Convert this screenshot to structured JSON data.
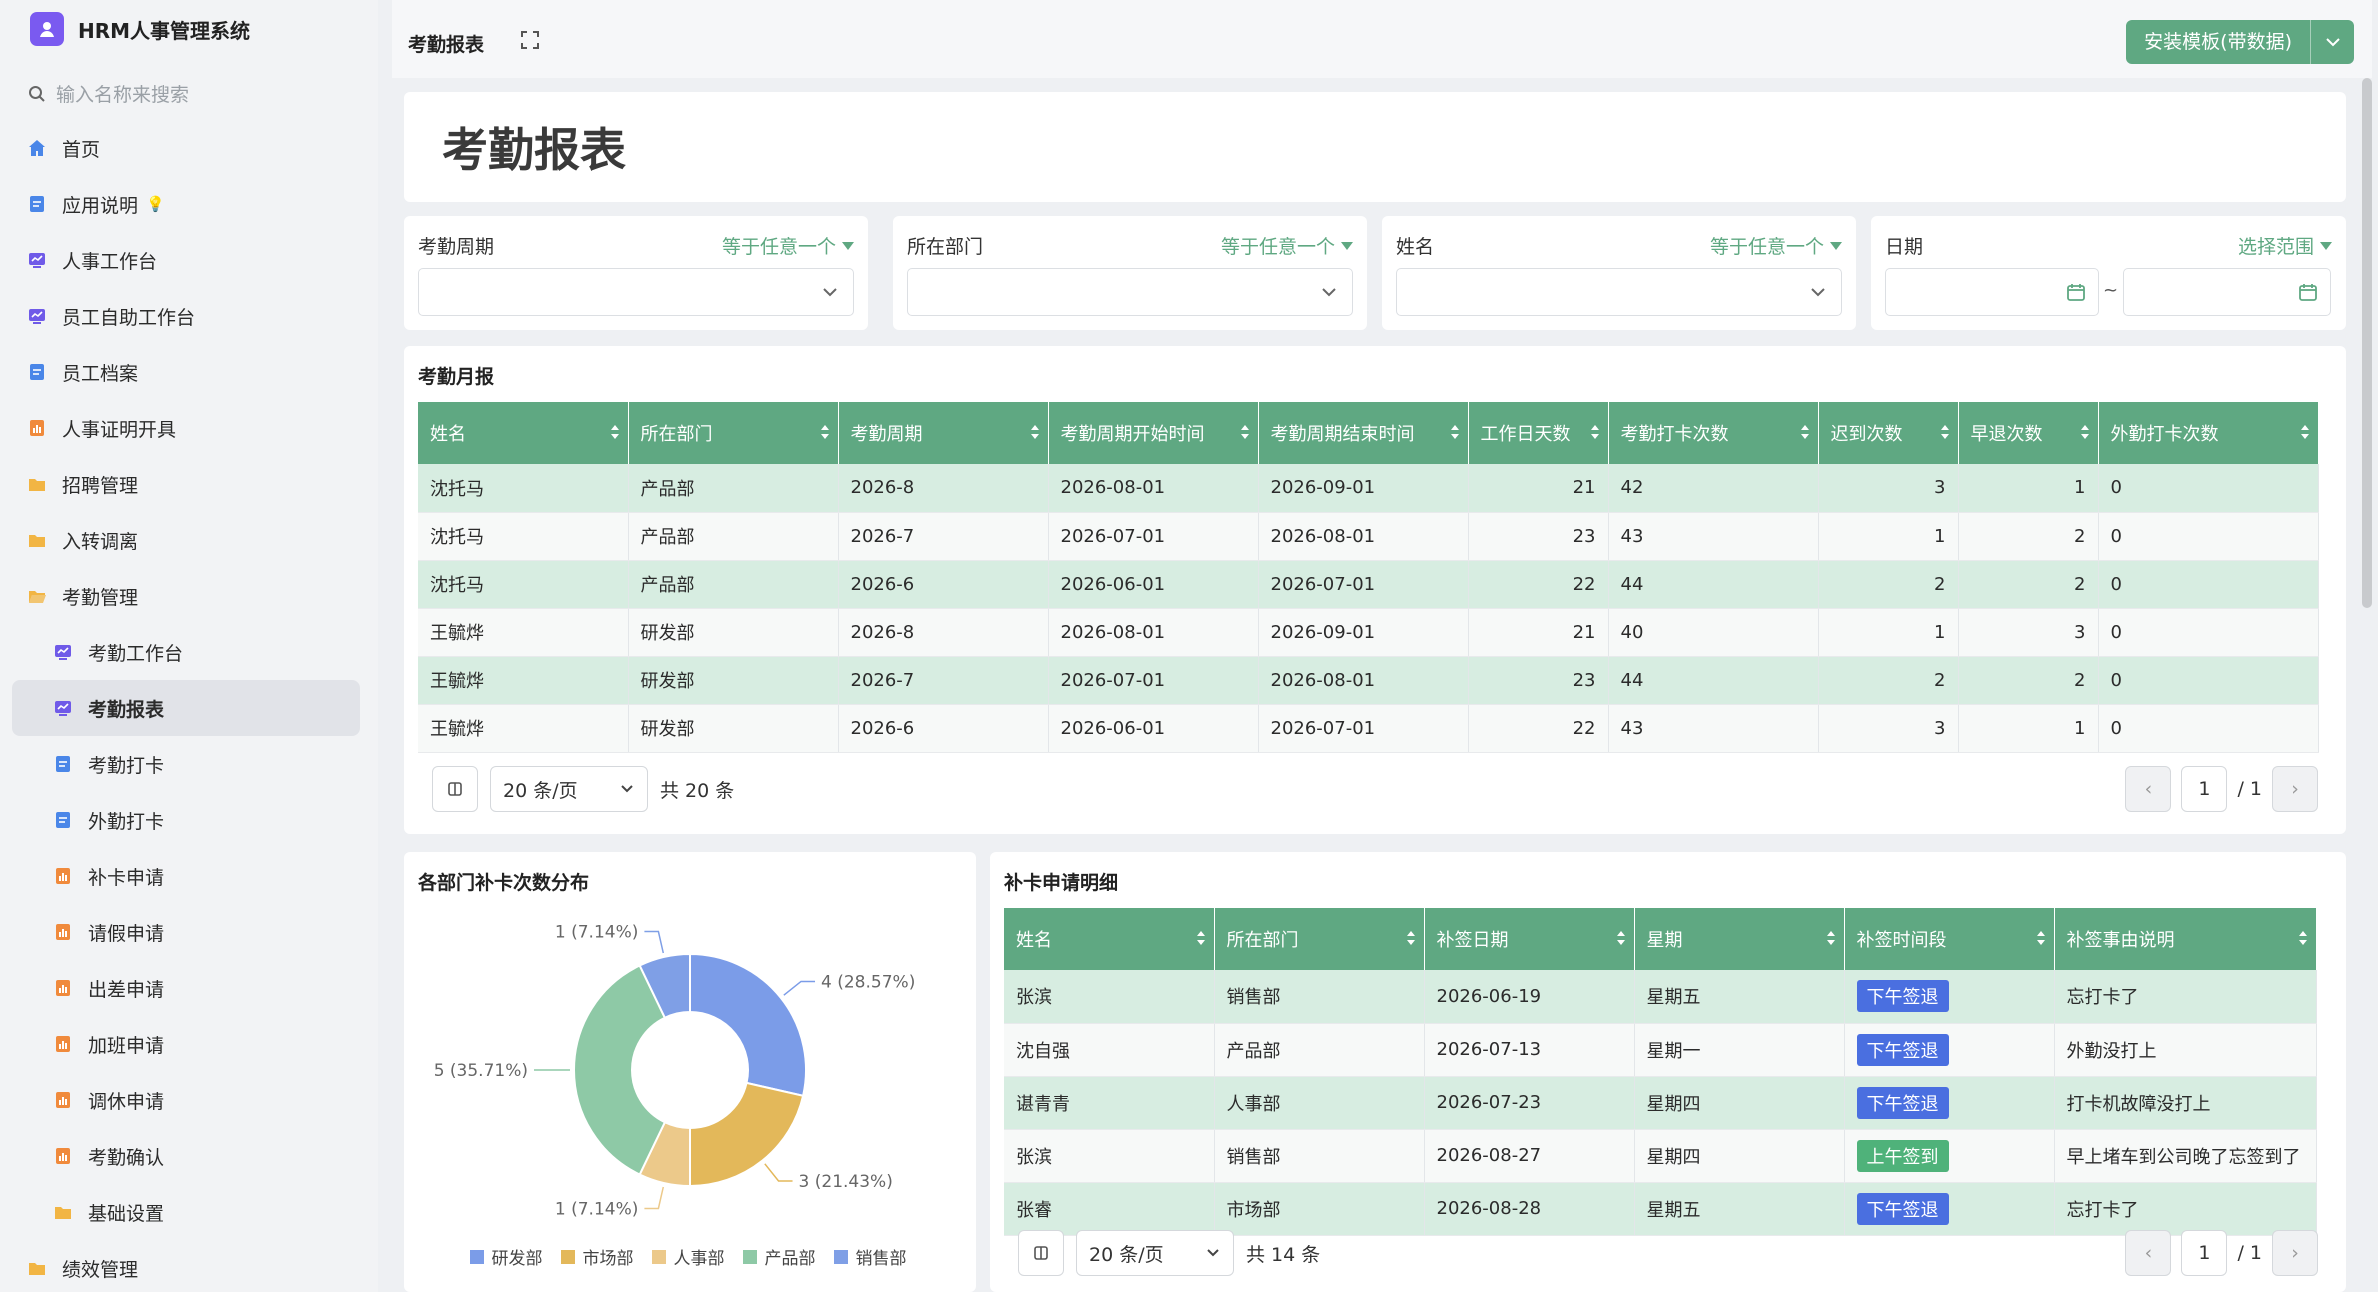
{
  "app": {
    "title": "HRM人事管理系统"
  },
  "search": {
    "placeholder": "输入名称来搜索"
  },
  "sidebar": {
    "items": [
      {
        "label": "首页",
        "icon": "home-icon",
        "color": "#4a86e8",
        "child": false
      },
      {
        "label": "应用说明",
        "icon": "doc-icon",
        "color": "#4a86e8",
        "child": false,
        "suffix": "💡"
      },
      {
        "label": "人事工作台",
        "icon": "dashboard-icon",
        "color": "#6f5ae8",
        "child": false
      },
      {
        "label": "员工自助工作台",
        "icon": "dashboard-icon",
        "color": "#6f5ae8",
        "child": false
      },
      {
        "label": "员工档案",
        "icon": "doc-icon",
        "color": "#4a86e8",
        "child": false
      },
      {
        "label": "人事证明开具",
        "icon": "report-icon",
        "color": "#f08a3c",
        "child": false
      },
      {
        "label": "招聘管理",
        "icon": "folder-icon",
        "color": "#f2b544",
        "child": false
      },
      {
        "label": "入转调离",
        "icon": "folder-icon",
        "color": "#f2b544",
        "child": false
      },
      {
        "label": "考勤管理",
        "icon": "folder-open-icon",
        "color": "#f2b544",
        "child": false
      },
      {
        "label": "考勤工作台",
        "icon": "dashboard-icon",
        "color": "#6f5ae8",
        "child": true
      },
      {
        "label": "考勤报表",
        "icon": "dashboard-icon",
        "color": "#6f5ae8",
        "child": true,
        "active": true
      },
      {
        "label": "考勤打卡",
        "icon": "doc-icon",
        "color": "#4a86e8",
        "child": true
      },
      {
        "label": "外勤打卡",
        "icon": "doc-icon",
        "color": "#4a86e8",
        "child": true
      },
      {
        "label": "补卡申请",
        "icon": "report-icon",
        "color": "#f08a3c",
        "child": true
      },
      {
        "label": "请假申请",
        "icon": "report-icon",
        "color": "#f08a3c",
        "child": true
      },
      {
        "label": "出差申请",
        "icon": "report-icon",
        "color": "#f08a3c",
        "child": true
      },
      {
        "label": "加班申请",
        "icon": "report-icon",
        "color": "#f08a3c",
        "child": true
      },
      {
        "label": "调休申请",
        "icon": "report-icon",
        "color": "#f08a3c",
        "child": true
      },
      {
        "label": "考勤确认",
        "icon": "report-icon",
        "color": "#f08a3c",
        "child": true
      },
      {
        "label": "基础设置",
        "icon": "folder-icon",
        "color": "#f2b544",
        "child": true
      },
      {
        "label": "绩效管理",
        "icon": "folder-icon",
        "color": "#f2b544",
        "child": false
      }
    ]
  },
  "topbar": {
    "breadcrumb": "考勤报表",
    "install_label": "安装模板(带数据)"
  },
  "page": {
    "title": "考勤报表"
  },
  "filters": [
    {
      "label": "考勤周期",
      "op": "等于任意一个"
    },
    {
      "label": "所在部门",
      "op": "等于任意一个"
    },
    {
      "label": "姓名",
      "op": "等于任意一个"
    },
    {
      "label": "日期",
      "op": "选择范围",
      "separator": "~"
    }
  ],
  "monthly": {
    "title": "考勤月报",
    "columns": [
      "姓名",
      "所在部门",
      "考勤周期",
      "考勤周期开始时间",
      "考勤周期结束时间",
      "工作日天数",
      "考勤打卡次数",
      "迟到次数",
      "早退次数",
      "外勤打卡次数"
    ],
    "rows": [
      [
        "沈托马",
        "产品部",
        "2026-8",
        "2026-08-01",
        "2026-09-01",
        "21",
        "42",
        "3",
        "1",
        "0"
      ],
      [
        "沈托马",
        "产品部",
        "2026-7",
        "2026-07-01",
        "2026-08-01",
        "23",
        "43",
        "1",
        "2",
        "0"
      ],
      [
        "沈托马",
        "产品部",
        "2026-6",
        "2026-06-01",
        "2026-07-01",
        "22",
        "44",
        "2",
        "2",
        "0"
      ],
      [
        "王毓烨",
        "研发部",
        "2026-8",
        "2026-08-01",
        "2026-09-01",
        "21",
        "40",
        "1",
        "3",
        "0"
      ],
      [
        "王毓烨",
        "研发部",
        "2026-7",
        "2026-07-01",
        "2026-08-01",
        "23",
        "44",
        "2",
        "2",
        "0"
      ],
      [
        "王毓烨",
        "研发部",
        "2026-6",
        "2026-06-01",
        "2026-07-01",
        "22",
        "43",
        "3",
        "1",
        "0"
      ]
    ],
    "pager": {
      "size_label": "20 条/页",
      "total_label": "共 20 条",
      "page": "1",
      "pages_label": "/ 1"
    }
  },
  "chart_title": "各部门补卡次数分布",
  "chart_data": {
    "type": "pie",
    "donut": true,
    "categories": [
      "研发部",
      "市场部",
      "人事部",
      "产品部",
      "销售部"
    ],
    "values": [
      4,
      3,
      1,
      5,
      1
    ],
    "percent_labels": [
      "4 (28.57%)",
      "3 (21.43%)",
      "1 (7.14%)",
      "5 (35.71%)",
      "1 (7.14%)"
    ],
    "colors": [
      "#7b9ce8",
      "#e3b85a",
      "#ecc98a",
      "#8ec9a6",
      "#7f9fe6"
    ],
    "legend": "bottom"
  },
  "detail": {
    "title": "补卡申请明细",
    "columns": [
      "姓名",
      "所在部门",
      "补签日期",
      "星期",
      "补签时间段",
      "补签事由说明"
    ],
    "rows": [
      [
        "张滨",
        "销售部",
        "2026-06-19",
        "星期五",
        "下午签退",
        "忘打卡了"
      ],
      [
        "沈自强",
        "产品部",
        "2026-07-13",
        "星期一",
        "下午签退",
        "外勤没打上"
      ],
      [
        "谌青青",
        "人事部",
        "2026-07-23",
        "星期四",
        "下午签退",
        "打卡机故障没打上"
      ],
      [
        "张滨",
        "销售部",
        "2026-08-27",
        "星期四",
        "上午签到",
        "早上堵车到公司晚了忘签到了"
      ],
      [
        "张睿",
        "市场部",
        "2026-08-28",
        "星期五",
        "下午签退",
        "忘打卡了"
      ]
    ],
    "tag_colors": {
      "下午签退": "#4a6fe0",
      "上午签到": "#4fb27a"
    },
    "pager": {
      "size_label": "20 条/页",
      "total_label": "共 14 条",
      "page": "1",
      "pages_label": "/ 1"
    }
  }
}
